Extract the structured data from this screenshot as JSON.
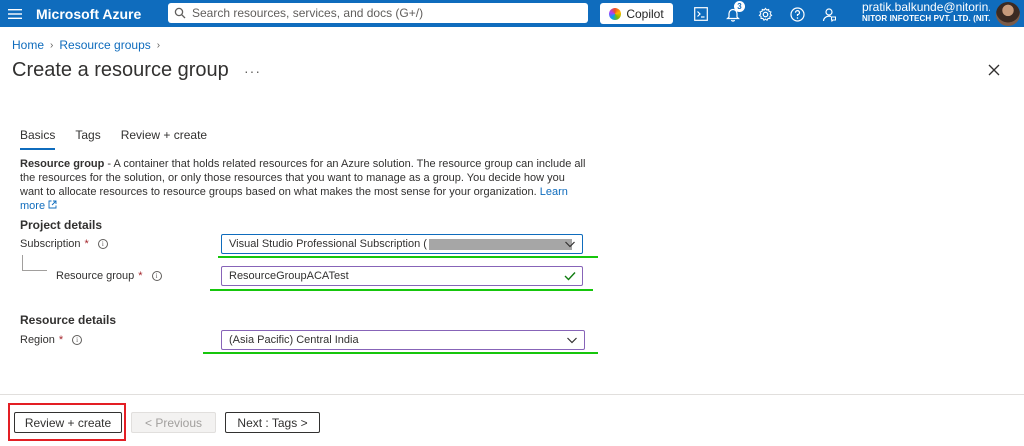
{
  "topbar": {
    "brand": "Microsoft Azure",
    "search_placeholder": "Search resources, services, and docs (G+/)",
    "copilot_label": "Copilot",
    "notification_count": "3",
    "account_name": "pratik.balkunde@nitorin...",
    "account_org": "NITOR INFOTECH PVT. LTD. (NIT...",
    "colors": {
      "bar": "#0f6cbd"
    },
    "icons": [
      "menu-icon",
      "search-icon",
      "copilot-icon",
      "cloud-shell-icon",
      "notifications-icon",
      "settings-icon",
      "help-icon",
      "feedback-icon"
    ]
  },
  "breadcrumb": {
    "home": "Home",
    "resource_groups": "Resource groups"
  },
  "page": {
    "title": "Create a resource group",
    "more": "···"
  },
  "tabs": [
    {
      "label": "Basics",
      "active": true
    },
    {
      "label": "Tags",
      "active": false
    },
    {
      "label": "Review + create",
      "active": false
    }
  ],
  "description": {
    "bold": "Resource group",
    "text": " - A container that holds related resources for an Azure solution. The resource group can include all the resources for the solution, or only those resources that you want to manage as a group. You decide how you want to allocate resources to resource groups based on what makes the most sense for your organization.",
    "learn_more": "Learn more"
  },
  "project_details": {
    "title": "Project details",
    "subscription_label": "Subscription",
    "subscription_value": "Visual Studio Professional Subscription (",
    "resource_group_label": "Resource group",
    "resource_group_value": "ResourceGroupACATest"
  },
  "resource_details": {
    "title": "Resource details",
    "region_label": "Region",
    "region_value": "(Asia Pacific) Central India"
  },
  "required_mark": "*",
  "footer": {
    "review_create": "Review + create",
    "previous": "< Previous",
    "next": "Next : Tags >"
  },
  "annotations": {
    "green": "#16c60c",
    "red": "#e31e24"
  }
}
